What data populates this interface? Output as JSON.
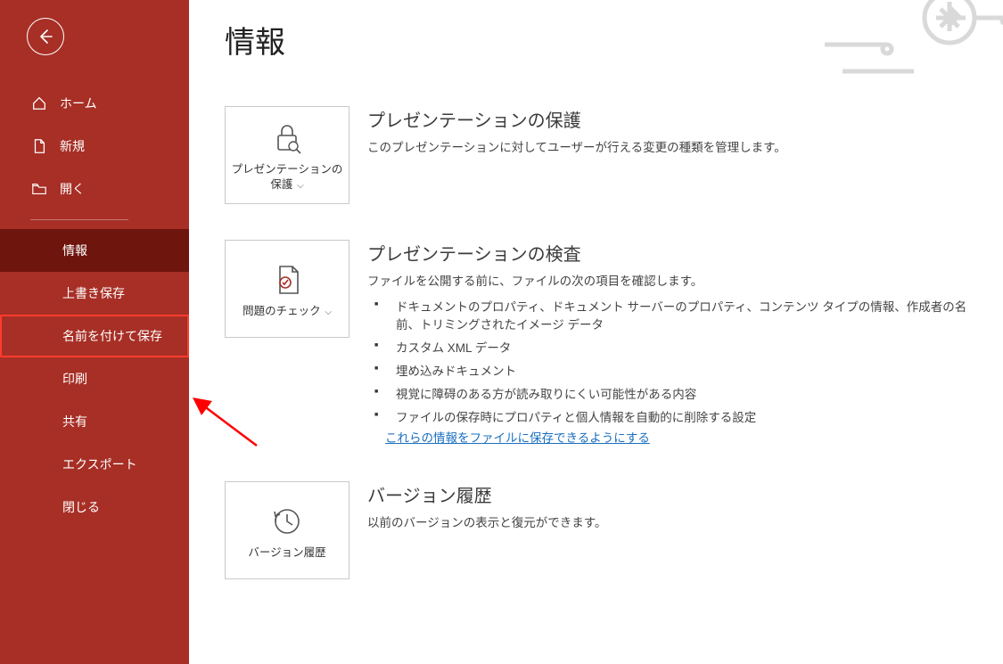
{
  "sidebar": {
    "items": [
      {
        "label": "ホーム",
        "key": "home"
      },
      {
        "label": "新規",
        "key": "new"
      },
      {
        "label": "開く",
        "key": "open"
      },
      {
        "label": "情報",
        "key": "info"
      },
      {
        "label": "上書き保存",
        "key": "save"
      },
      {
        "label": "名前を付けて保存",
        "key": "save-as"
      },
      {
        "label": "印刷",
        "key": "print"
      },
      {
        "label": "共有",
        "key": "share"
      },
      {
        "label": "エクスポート",
        "key": "export"
      },
      {
        "label": "閉じる",
        "key": "close"
      }
    ]
  },
  "main": {
    "title": "情報",
    "sections": [
      {
        "card_label": "プレゼンテーションの保護",
        "heading": "プレゼンテーションの保護",
        "description": "このプレゼンテーションに対してユーザーが行える変更の種類を管理します。"
      },
      {
        "card_label": "問題のチェック",
        "heading": "プレゼンテーションの検査",
        "description": "ファイルを公開する前に、ファイルの次の項目を確認します。",
        "bullets": [
          "ドキュメントのプロパティ、ドキュメント サーバーのプロパティ、コンテンツ タイプの情報、作成者の名前、トリミングされたイメージ データ",
          "カスタム XML データ",
          "埋め込みドキュメント",
          "視覚に障碍のある方が読み取りにくい可能性がある内容",
          "ファイルの保存時にプロパティと個人情報を自動的に削除する設定"
        ],
        "link": "これらの情報をファイルに保存できるようにする"
      },
      {
        "card_label": "バージョン履歴",
        "heading": "バージョン履歴",
        "description": "以前のバージョンの表示と復元ができます。"
      }
    ]
  }
}
